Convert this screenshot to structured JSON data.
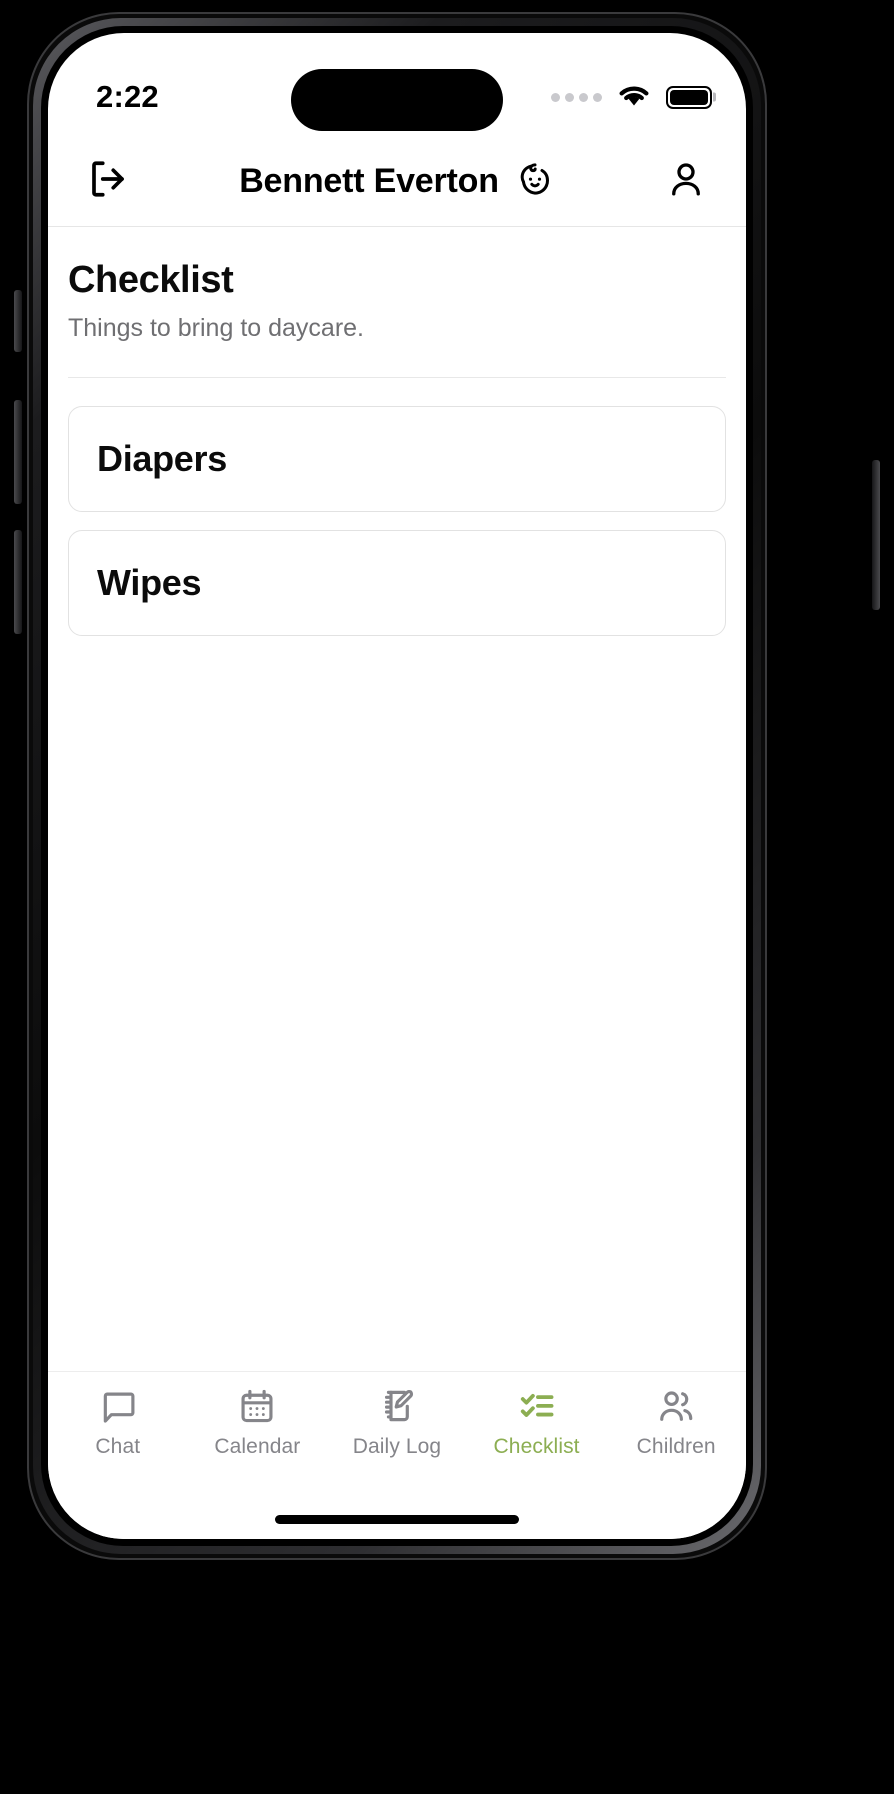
{
  "status_bar": {
    "time": "2:22",
    "cellular_icon": "cellular-dots-icon",
    "wifi_icon": "wifi-icon",
    "battery_icon": "battery-icon"
  },
  "header": {
    "logout_icon": "logout-icon",
    "title": "Bennett Everton",
    "baby_icon": "baby-face-icon",
    "account_icon": "person-icon"
  },
  "main": {
    "title": "Checklist",
    "subtitle": "Things to bring to daycare.",
    "items": [
      {
        "label": "Diapers"
      },
      {
        "label": "Wipes"
      }
    ]
  },
  "tab_bar": {
    "active_color": "#8CAE52",
    "inactive_color": "#85858a",
    "tabs": [
      {
        "label": "Chat",
        "icon": "chat-bubble-icon",
        "active": false
      },
      {
        "label": "Calendar",
        "icon": "calendar-icon",
        "active": false
      },
      {
        "label": "Daily Log",
        "icon": "notebook-pencil-icon",
        "active": false
      },
      {
        "label": "Checklist",
        "icon": "checklist-icon",
        "active": true
      },
      {
        "label": "Children",
        "icon": "people-icon",
        "active": false
      }
    ]
  }
}
